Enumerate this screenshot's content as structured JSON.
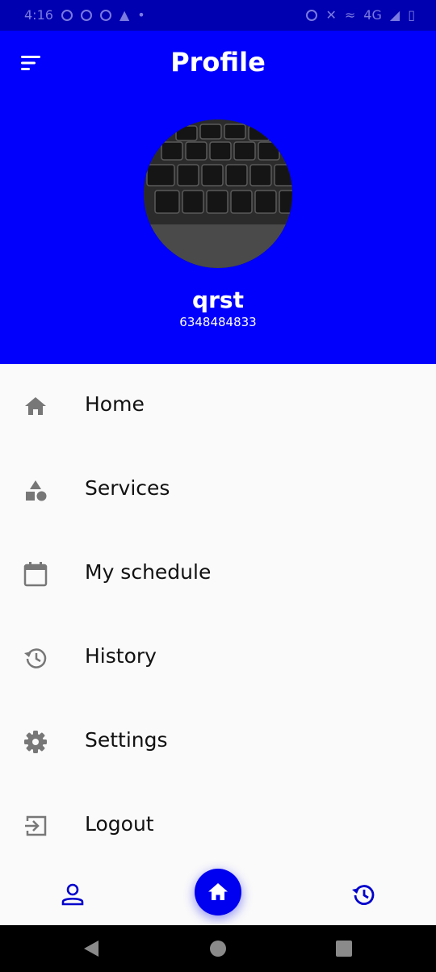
{
  "status_bar": {
    "time": "4:16",
    "network": "4G"
  },
  "header": {
    "title": "Profile"
  },
  "profile": {
    "name": "qrst",
    "phone": "6348484833"
  },
  "menu": [
    {
      "label": "Home",
      "icon": "home-icon"
    },
    {
      "label": "Services",
      "icon": "services-icon"
    },
    {
      "label": "My schedule",
      "icon": "calendar-icon"
    },
    {
      "label": "History",
      "icon": "history-icon"
    },
    {
      "label": "Settings",
      "icon": "gear-icon"
    },
    {
      "label": "Logout",
      "icon": "logout-icon"
    }
  ],
  "bottom_nav": {
    "left": "person-icon",
    "center": "home-icon",
    "right": "history-icon"
  },
  "colors": {
    "primary": "#0000fc",
    "status_bar": "#0000b0",
    "icon_gray": "#777777",
    "background": "#fafafa"
  }
}
